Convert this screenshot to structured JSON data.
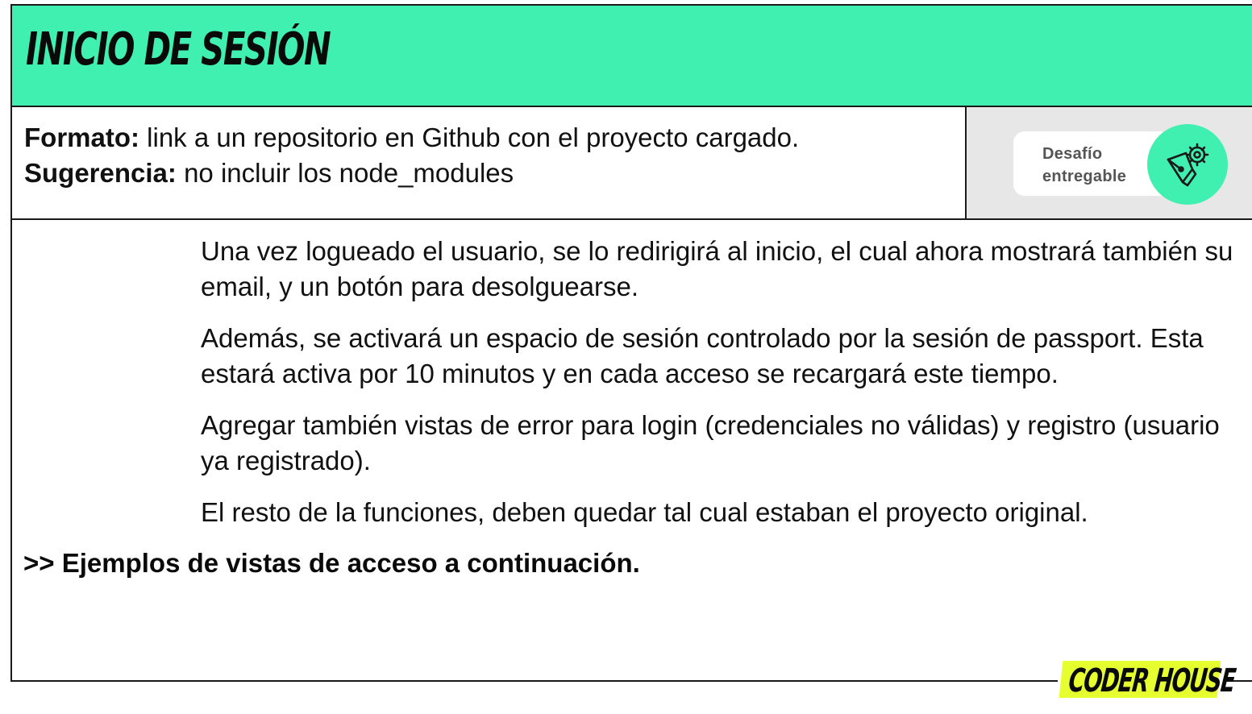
{
  "header": {
    "title": "INICIO DE SESIÓN"
  },
  "info": {
    "format_label": "Formato:",
    "format_text": " link a un repositorio en Github con el proyecto cargado.",
    "suggestion_label": "Sugerencia:",
    "suggestion_text": " no incluir los node_modules"
  },
  "badge": {
    "line1": "Desafío",
    "line2": "entregable",
    "icon": "pen-gear-icon"
  },
  "body": {
    "paragraphs": [
      "Una vez logueado el usuario, se lo redirigirá al inicio, el cual ahora mostrará también su email, y un botón para desolguearse.",
      "Además, se activará un espacio de sesión controlado por la sesión de passport. Esta estará activa por 10 minutos y en cada acceso se recargará este tiempo.",
      "Agregar también vistas de error para login (credenciales no válidas) y registro (usuario ya registrado).",
      "El resto de la funciones, deben quedar tal cual estaban el proyecto original."
    ],
    "conclusion": ">> Ejemplos de vistas de acceso a continuación."
  },
  "footer": {
    "logo_text": "CODER HOUSE"
  },
  "colors": {
    "header_bg": "#3ff0b0",
    "badge_circle": "#3ff0b0",
    "logo_bg": "#e6ff2e",
    "badge_panel_bg": "#e7e7e7"
  }
}
